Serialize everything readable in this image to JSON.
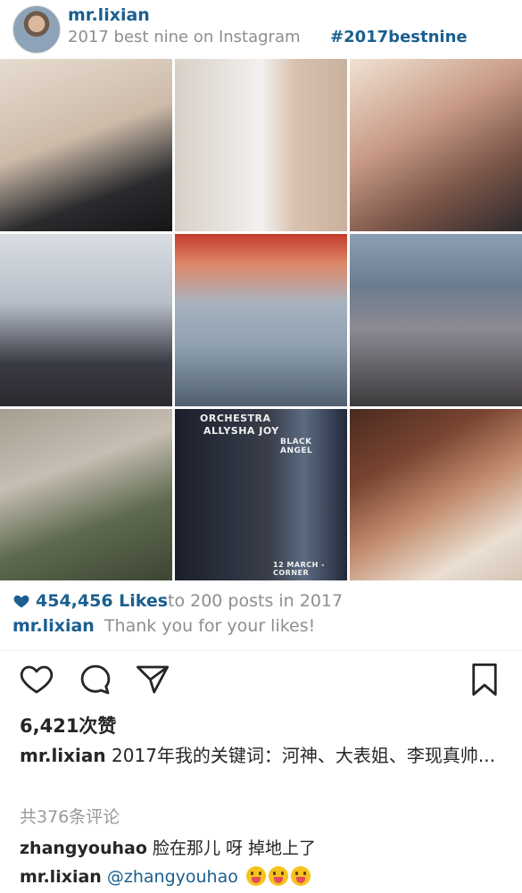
{
  "header": {
    "username": "mr.lixian",
    "subtitle": "2017 best nine on Instagram",
    "hashtag": "#2017bestnine"
  },
  "grid": {
    "tiles": [
      {
        "name": "photo-1"
      },
      {
        "name": "photo-2"
      },
      {
        "name": "photo-3"
      },
      {
        "name": "photo-4"
      },
      {
        "name": "photo-5"
      },
      {
        "name": "photo-6"
      },
      {
        "name": "photo-7"
      },
      {
        "name": "photo-8"
      },
      {
        "name": "photo-9"
      }
    ],
    "poster_lines": [
      "ORCHESTRA",
      "ALLYSHA JOY",
      "BLACK ANGEL",
      "12 MARCH - CORNER"
    ]
  },
  "summary": {
    "likes_count": "454,456 Likes",
    "likes_suffix": "to 200 posts in 2017",
    "thanks_user": "mr.lixian",
    "thanks_text": "Thank you for your likes!"
  },
  "actions": {
    "like_icon": "heart-icon",
    "comment_icon": "comment-icon",
    "share_icon": "send-icon",
    "save_icon": "bookmark-icon"
  },
  "post": {
    "like_total": "6,421次赞",
    "caption_user": "mr.lixian",
    "caption_text": "2017年我的关键词：河神、大表姐、李现真帅...",
    "comments_link": "共376条评论"
  },
  "comments": [
    {
      "user": "zhangyouhao",
      "text": "脸在那儿 呀 掉地上了"
    },
    {
      "user": "mr.lixian",
      "mention": "@zhangyouhao",
      "emoji_count": 3
    }
  ],
  "colors": {
    "link_blue": "#1a5f8f",
    "muted_gray": "#8e8e8e",
    "text_dark": "#262626"
  }
}
